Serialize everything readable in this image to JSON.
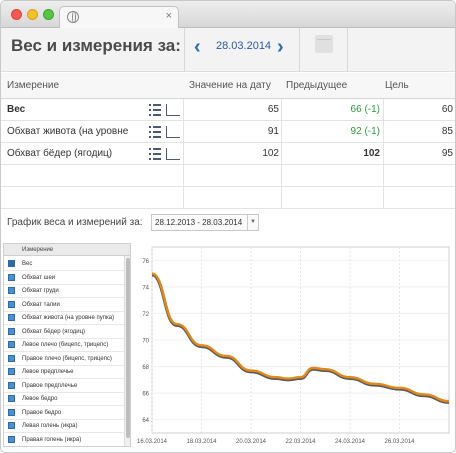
{
  "header": {
    "title": "Вес и измерения за:",
    "date": "28.03.2014",
    "prev_icon": "chevron-left-icon",
    "next_icon": "chevron-right-icon",
    "calendar_icon": "calendar-icon"
  },
  "table": {
    "columns": [
      "Измерение",
      "Значение на дату",
      "Предыдущее",
      "Цель"
    ],
    "rows": [
      {
        "name": "Вес",
        "value": "65",
        "previous": "66 (-1)",
        "previous_color": "green",
        "target": "60"
      },
      {
        "name": "Обхват живота (на уровне",
        "value": "91",
        "previous": "92 (-1)",
        "previous_color": "green",
        "target": "85"
      },
      {
        "name": "Обхват бёдер (ягодиц)",
        "value": "102",
        "previous": "102",
        "previous_color": "black",
        "target": "95"
      }
    ]
  },
  "chart_section": {
    "title": "График веса и измерений за:",
    "range": "28.12.2013 - 28.03.2014"
  },
  "measure_list": {
    "header": "Измерение",
    "items": [
      {
        "label": "Вес",
        "checked": true
      },
      {
        "label": "Обхват шеи",
        "checked": false
      },
      {
        "label": "Обхват груди",
        "checked": false
      },
      {
        "label": "Обхват талии",
        "checked": false
      },
      {
        "label": "Обхват живота (на уровне пупка)",
        "checked": false
      },
      {
        "label": "Обхват бёдер (ягодиц)",
        "checked": false
      },
      {
        "label": "Левое плечо (бицепс, трицепс)",
        "checked": false
      },
      {
        "label": "Правое плечо (бицепс, трицепс)",
        "checked": false
      },
      {
        "label": "Левое предплечье",
        "checked": false
      },
      {
        "label": "Правое предплечье",
        "checked": false
      },
      {
        "label": "Левое бедро",
        "checked": false
      },
      {
        "label": "Правое бедро",
        "checked": false
      },
      {
        "label": "Левая голень (икра)",
        "checked": false
      },
      {
        "label": "Правая голень (икра)",
        "checked": false
      }
    ]
  },
  "chart_data": {
    "type": "line",
    "title": "",
    "xlabel": "",
    "ylabel": "",
    "x_tick_labels": [
      "16.03.2014",
      "18.03.2014",
      "20.03.2014",
      "22.03.2014",
      "24.03.2014",
      "26.03.2014"
    ],
    "y_ticks": [
      64,
      66,
      68,
      70,
      72,
      74,
      76
    ],
    "xlim": [
      "2014-03-16",
      "2014-03-28"
    ],
    "ylim": [
      63,
      77
    ],
    "series": [
      {
        "name": "Вес",
        "color": "#e08a1e",
        "shadow_color": "#5a5a5a",
        "x": [
          "2014-03-16",
          "2014-03-17",
          "2014-03-18",
          "2014-03-19",
          "2014-03-20",
          "2014-03-21",
          "2014-03-21.5",
          "2014-03-22",
          "2014-03-22.5",
          "2014-03-23",
          "2014-03-24",
          "2014-03-25",
          "2014-03-26",
          "2014-03-27",
          "2014-03-28"
        ],
        "values": [
          75.0,
          71.2,
          69.6,
          68.8,
          67.7,
          67.2,
          67.1,
          67.2,
          67.9,
          67.8,
          67.2,
          66.7,
          66.4,
          65.9,
          65.4
        ]
      }
    ],
    "grid": true
  }
}
